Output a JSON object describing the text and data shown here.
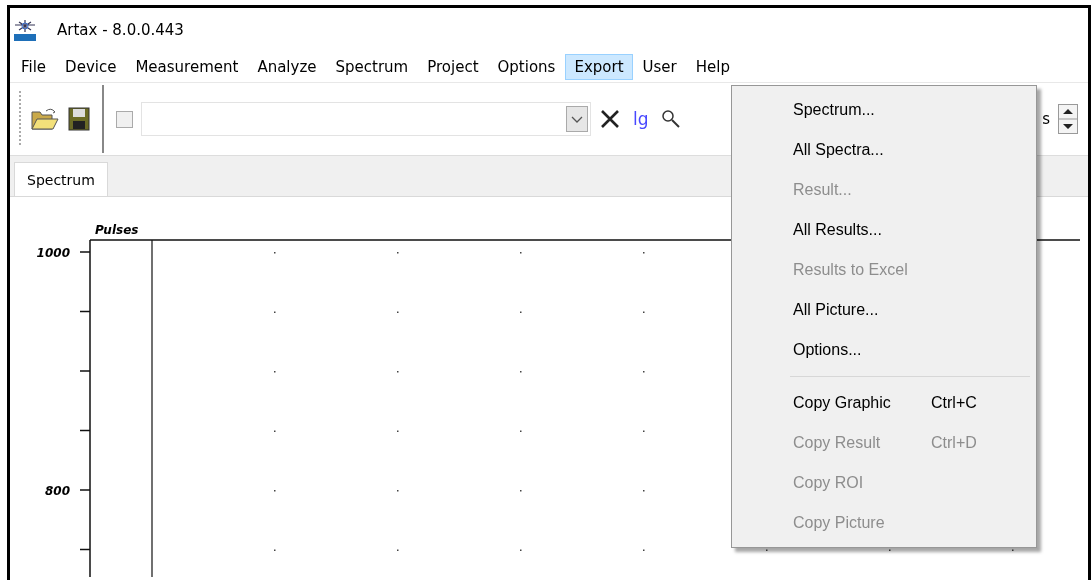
{
  "window": {
    "title": "Artax - 8.0.0.443"
  },
  "menubar": [
    {
      "label": "File",
      "selected": false
    },
    {
      "label": "Device",
      "selected": false
    },
    {
      "label": "Measurement",
      "selected": false
    },
    {
      "label": "Analyze",
      "selected": false
    },
    {
      "label": "Spectrum",
      "selected": false
    },
    {
      "label": "Project",
      "selected": false
    },
    {
      "label": "Options",
      "selected": false
    },
    {
      "label": "Export",
      "selected": true
    },
    {
      "label": "User",
      "selected": false
    },
    {
      "label": "Help",
      "selected": false
    }
  ],
  "toolbar": {
    "checkbox": {
      "checked": false
    },
    "log_button": "lg",
    "cut_label": "s"
  },
  "tabs": [
    {
      "label": "Spectrum",
      "selected": true
    }
  ],
  "plot": {
    "axis_title": "Pulses",
    "y_labels": [
      "1000",
      "800"
    ]
  },
  "export_menu": [
    {
      "kind": "item",
      "label": "Spectrum...",
      "disabled": false
    },
    {
      "kind": "item",
      "label": "All Spectra...",
      "disabled": false
    },
    {
      "kind": "item",
      "label": "Result...",
      "disabled": true
    },
    {
      "kind": "item",
      "label": "All Results...",
      "disabled": false
    },
    {
      "kind": "item",
      "label": "Results to Excel",
      "disabled": true
    },
    {
      "kind": "item",
      "label": "All Picture...",
      "disabled": false
    },
    {
      "kind": "item",
      "label": "Options...",
      "disabled": false
    },
    {
      "kind": "separator"
    },
    {
      "kind": "item",
      "label": "Copy Graphic",
      "shortcut": "Ctrl+C",
      "disabled": false
    },
    {
      "kind": "item",
      "label": "Copy Result",
      "shortcut": "Ctrl+D",
      "disabled": true
    },
    {
      "kind": "item",
      "label": "Copy ROI",
      "disabled": true
    },
    {
      "kind": "item",
      "label": "Copy Picture",
      "disabled": true
    }
  ]
}
